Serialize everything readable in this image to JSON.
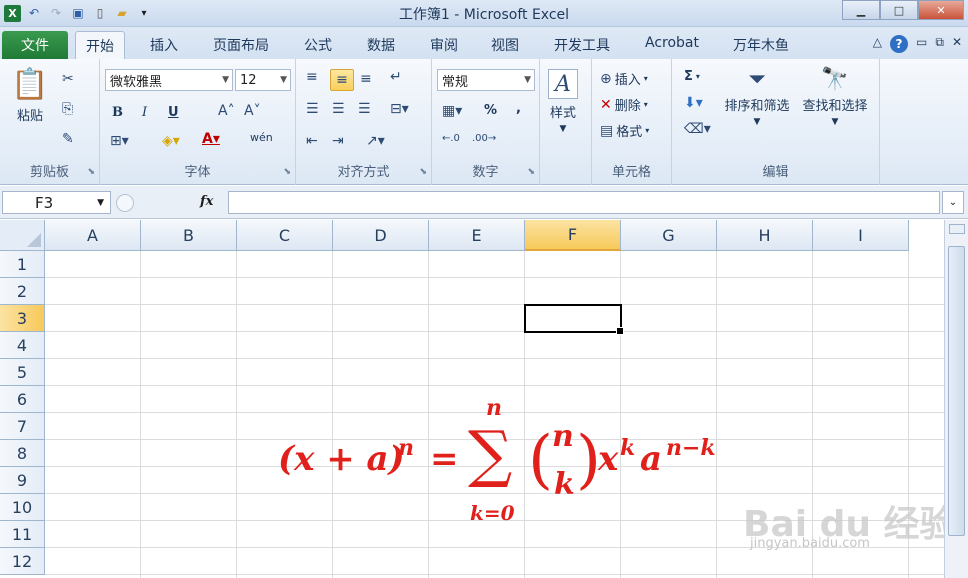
{
  "title": {
    "text": "工作簿1  -  Microsoft Excel"
  },
  "window": {
    "minimize": "▁",
    "maximize": "□",
    "close": "✕"
  },
  "tabs": {
    "file": "文件",
    "items": [
      "开始",
      "插入",
      "页面布局",
      "公式",
      "数据",
      "审阅",
      "视图",
      "开发工具",
      "Acrobat",
      "万年木鱼"
    ]
  },
  "ribbon": {
    "clipboard": {
      "paste": "粘贴",
      "group": "剪贴板"
    },
    "font": {
      "name": "微软雅黑",
      "size": "12",
      "bold": "B",
      "italic": "I",
      "underline": "U",
      "group": "字体",
      "phonetic": "wén"
    },
    "align": {
      "group": "对齐方式"
    },
    "number": {
      "format": "常规",
      "percent": "%",
      "comma": ",",
      "group": "数字"
    },
    "styles": {
      "label": "样式"
    },
    "cells": {
      "insert": "插入",
      "delete": "删除",
      "format": "格式",
      "group": "单元格"
    },
    "editing": {
      "sort": "排序和筛选",
      "find": "查找和选择",
      "group": "编辑",
      "sum": "Σ"
    }
  },
  "formula_bar": {
    "name_box": "F3",
    "fx": "fx",
    "value": ""
  },
  "sheet": {
    "columns": [
      "A",
      "B",
      "C",
      "D",
      "E",
      "F",
      "G",
      "H",
      "I"
    ],
    "rows": [
      "1",
      "2",
      "3",
      "4",
      "5",
      "6",
      "7",
      "8",
      "9",
      "10",
      "11",
      "12"
    ],
    "selected_column": "F",
    "selected_row": "3"
  },
  "equation": {
    "lhs": "(x + a)",
    "lhs_exp": "n",
    "equals": "=",
    "sigma": "∑",
    "sigma_top": "n",
    "sigma_bottom": "k=0",
    "binom_top": "n",
    "binom_bottom": "k",
    "x": "x",
    "x_exp": "k",
    "a": "a",
    "a_exp": "n−k"
  },
  "watermark": {
    "main": "Bai du 经验",
    "sub": "jingyan.baidu.com"
  }
}
